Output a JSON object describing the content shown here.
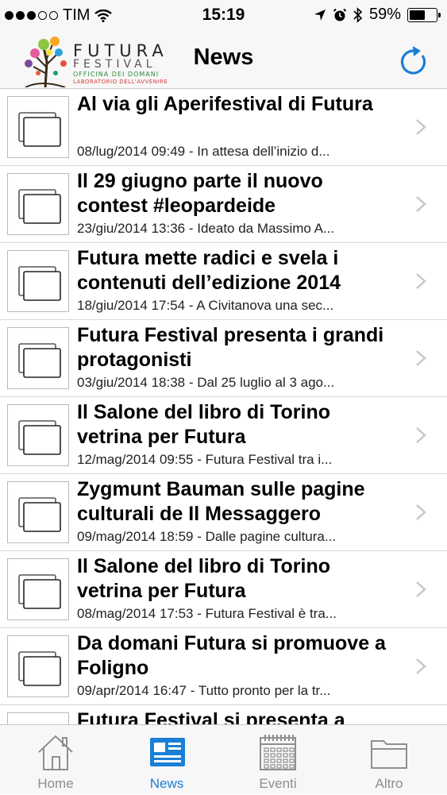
{
  "status_bar": {
    "carrier": "TIM",
    "time": "15:19",
    "battery": "59%",
    "battery_level": 0.59
  },
  "header": {
    "logo": {
      "title": "FUTURA",
      "subtitle": "FESTIVAL",
      "tagline1": "OFFICINA DEI DOMANI",
      "tagline2": "LABORATORIO DELL'AVVENIRE"
    },
    "title": "News",
    "refresh_icon": "refresh-icon"
  },
  "news": [
    {
      "title": "Al via gli Aperifestival di Futura",
      "subtitle": "08/lug/2014 09:49 - In attesa dell’inizio d..."
    },
    {
      "title": "Il 29 giugno parte il nuovo contest #leopardeide",
      "subtitle": "23/giu/2014 13:36 - Ideato da Massimo A..."
    },
    {
      "title": "Futura mette radici e svela i contenuti dell’edizione 2014",
      "subtitle": "18/giu/2014 17:54 - A Civitanova una sec..."
    },
    {
      "title": "Futura Festival presenta i grandi protagonisti",
      "subtitle": "03/giu/2014 18:38 - Dal 25 luglio al 3 ago..."
    },
    {
      "title": "Il Salone del libro di Torino vetrina per Futura",
      "subtitle": "12/mag/2014 09:55 - Futura Festival tra i..."
    },
    {
      "title": "Zygmunt Bauman sulle pagine culturali de Il Messaggero",
      "subtitle": "09/mag/2014 18:59 - Dalle pagine cultura..."
    },
    {
      "title": "Il Salone del libro di Torino vetrina per Futura",
      "subtitle": "08/mag/2014 17:53 - Futura Festival è tra..."
    },
    {
      "title": "Da domani Futura si promuove a Foligno",
      "subtitle": "09/apr/2014 16:47 - Tutto pronto per la tr..."
    },
    {
      "title": "Futura Festival si presenta a",
      "subtitle": ""
    }
  ],
  "tabs": [
    {
      "label": "Home",
      "icon": "home-icon",
      "active": false
    },
    {
      "label": "News",
      "icon": "newspaper-icon",
      "active": true
    },
    {
      "label": "Eventi",
      "icon": "calendar-icon",
      "active": false
    },
    {
      "label": "Altro",
      "icon": "folder-icon",
      "active": false
    }
  ],
  "colors": {
    "accent": "#1a7fd6",
    "inactive": "#8e8e93",
    "bar_background": "#f7f7f7"
  }
}
